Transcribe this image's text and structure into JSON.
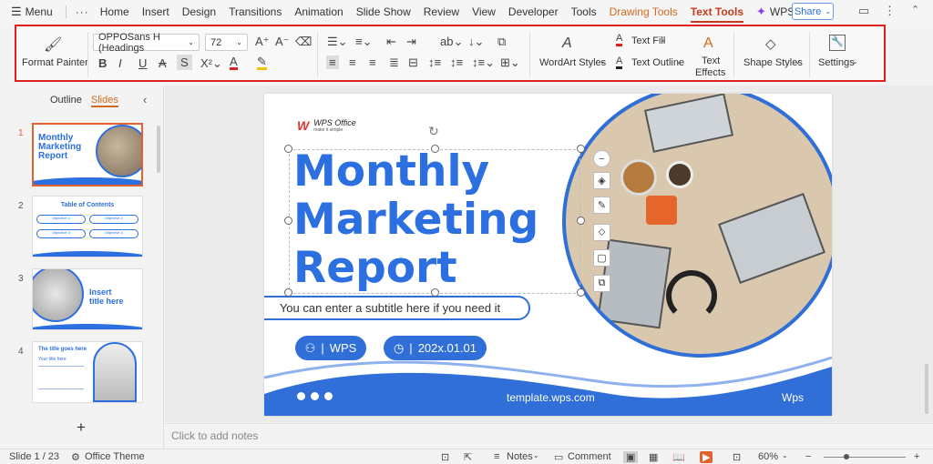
{
  "menubar": {
    "menu_label": "Menu",
    "dots": "···",
    "tabs": [
      "Home",
      "Insert",
      "Design",
      "Transitions",
      "Animation",
      "Slide Show",
      "Review",
      "View",
      "Developer",
      "Tools"
    ],
    "drawing_tools": "Drawing Tools",
    "text_tools": "Text Tools",
    "wps_ai": "WPS AI",
    "share": "Share"
  },
  "ribbon": {
    "format_painter": "Format Painter",
    "font_name": "OPPOSans H (Headings",
    "font_size": "72",
    "wordart_styles": "WordArt Styles",
    "text_fill": "Text Fill",
    "text_outline": "Text Outline",
    "text_effects_1": "Text",
    "text_effects_2": "Effects",
    "shape_styles": "Shape Styles",
    "settings": "Settings"
  },
  "left_panel": {
    "outline_tab": "Outline",
    "slides_tab": "Slides",
    "add": "+",
    "thumbnails": [
      {
        "num": "1",
        "title_lines": [
          "Monthly",
          "Marketing",
          "Report"
        ]
      },
      {
        "num": "2",
        "title": "Table of Contents",
        "items": [
          "Objective 1",
          "Objective 2",
          "Objective 3",
          "Objective 4"
        ]
      },
      {
        "num": "3",
        "title_lines": [
          "Insert",
          "title here"
        ]
      },
      {
        "num": "4",
        "title": "The title goes here",
        "sub": "Your title here"
      }
    ]
  },
  "slide": {
    "logo_name": "WPS Office",
    "logo_tag": "make it simple",
    "title_lines": [
      "Monthly",
      "Marketing",
      "Report"
    ],
    "subtitle": "You can enter a subtitle here if you need it",
    "author": "WPS",
    "date": "202x.01.01",
    "url": "template.wps.com",
    "brand": "Wps"
  },
  "notes_placeholder": "Click to add notes",
  "statusbar": {
    "slide_count": "Slide 1 / 23",
    "theme": "Office Theme",
    "notes": "Notes",
    "comment": "Comment",
    "zoom": "60%"
  },
  "colors": {
    "accent_blue": "#2f6fd7",
    "title_blue": "#2b6fe0",
    "active_tab": "#c13b1b",
    "highlight_box": "#e02020"
  }
}
